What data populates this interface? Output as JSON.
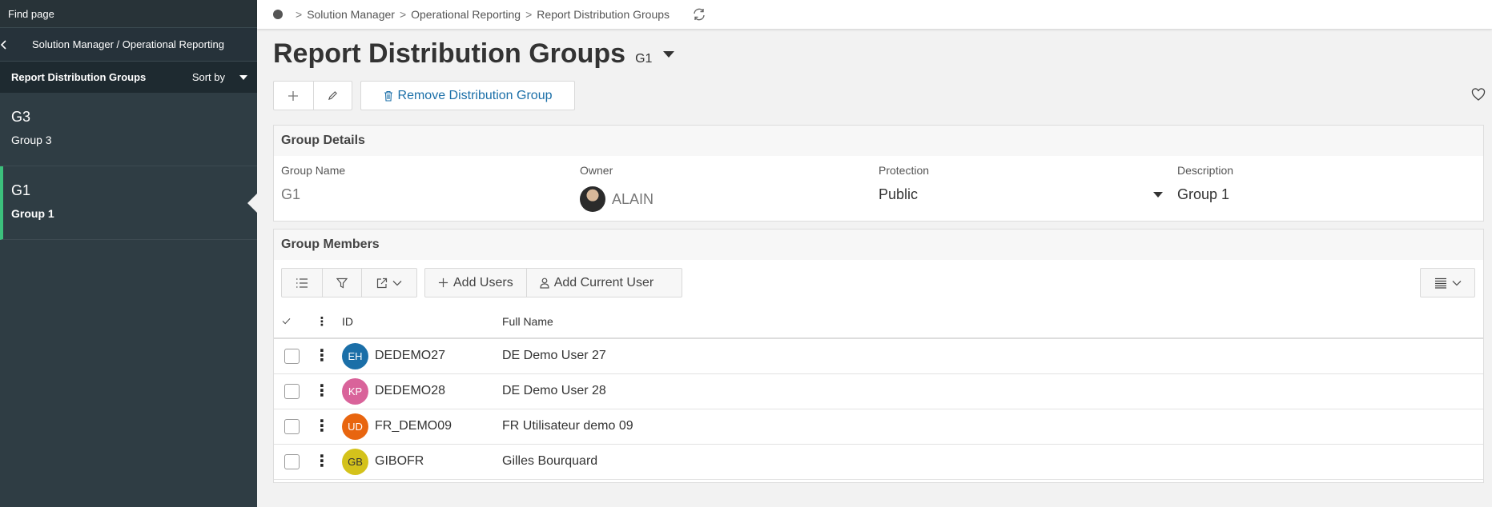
{
  "sidebar": {
    "find_page": "Find page",
    "back_path": "Solution Manager / Operational Reporting",
    "list_title": "Report Distribution Groups",
    "sort_label": "Sort by",
    "items": [
      {
        "code": "G3",
        "name": "Group 3",
        "active": false
      },
      {
        "code": "G1",
        "name": "Group 1",
        "active": true
      }
    ]
  },
  "breadcrumb": {
    "items": [
      "Solution Manager",
      "Operational Reporting",
      "Report Distribution Groups"
    ]
  },
  "page": {
    "title": "Report Distribution Groups",
    "selector": "G1",
    "remove_label": "Remove Distribution Group"
  },
  "details": {
    "header": "Group Details",
    "group_name_label": "Group Name",
    "group_name_value": "G1",
    "owner_label": "Owner",
    "owner_value": "ALAIN",
    "protection_label": "Protection",
    "protection_value": "Public",
    "description_label": "Description",
    "description_value": "Group 1"
  },
  "members": {
    "header": "Group Members",
    "add_users_label": "Add Users",
    "add_current_user_label": "Add Current User",
    "columns": {
      "id": "ID",
      "full_name": "Full Name"
    },
    "rows": [
      {
        "initials": "EH",
        "color": "#1b6fa8",
        "id": "DEDEMO27",
        "name": "DE Demo User 27"
      },
      {
        "initials": "KP",
        "color": "#d9639a",
        "id": "DEDEMO28",
        "name": "DE Demo User 28"
      },
      {
        "initials": "UD",
        "color": "#e8650f",
        "id": "FR_DEMO09",
        "name": "FR Utilisateur demo 09"
      },
      {
        "initials": "GB",
        "color": "#d4c21b",
        "id": "GIBOFR",
        "name": "Gilles Bourquard"
      }
    ]
  },
  "colors": {
    "accent": "#1b6fa8",
    "active_marker": "#3cc07c",
    "sidebar_bg": "#2f3d44"
  }
}
